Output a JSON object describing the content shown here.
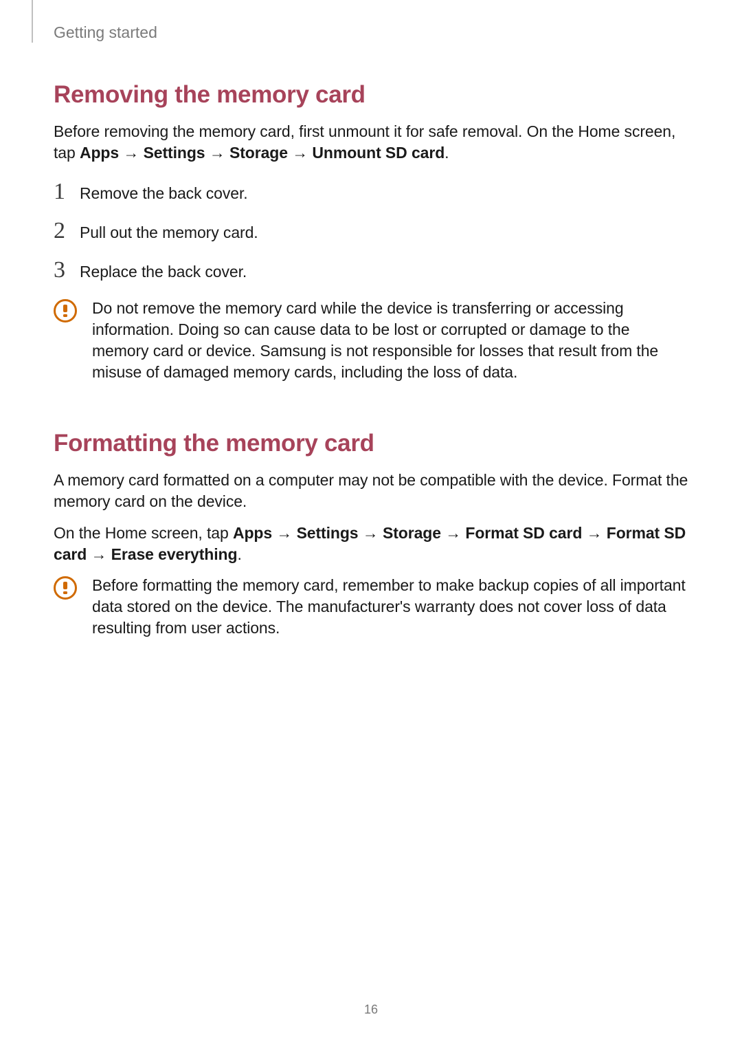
{
  "header": {
    "chapter": "Getting started"
  },
  "page_number": "16",
  "removing": {
    "heading": "Removing the memory card",
    "intro_pre": "Before removing the memory card, first unmount it for safe removal. On the Home screen, tap ",
    "path_parts": [
      "Apps",
      "Settings",
      "Storage",
      "Unmount SD card"
    ],
    "intro_post": ".",
    "steps": [
      {
        "n": "1",
        "text": "Remove the back cover."
      },
      {
        "n": "2",
        "text": "Pull out the memory card."
      },
      {
        "n": "3",
        "text": "Replace the back cover."
      }
    ],
    "warning": "Do not remove the memory card while the device is transferring or accessing information. Doing so can cause data to be lost or corrupted or damage to the memory card or device. Samsung is not responsible for losses that result from the misuse of damaged memory cards, including the loss of data."
  },
  "formatting": {
    "heading": "Formatting the memory card",
    "para1": "A memory card formatted on a computer may not be compatible with the device. Format the memory card on the device.",
    "para2_pre": "On the Home screen, tap ",
    "path_parts": [
      "Apps",
      "Settings",
      "Storage",
      "Format SD card",
      "Format SD card",
      "Erase everything"
    ],
    "para2_post": ".",
    "warning": "Before formatting the memory card, remember to make backup copies of all important data stored on the device. The manufacturer's warranty does not cover loss of data resulting from user actions."
  },
  "arrow": " → "
}
